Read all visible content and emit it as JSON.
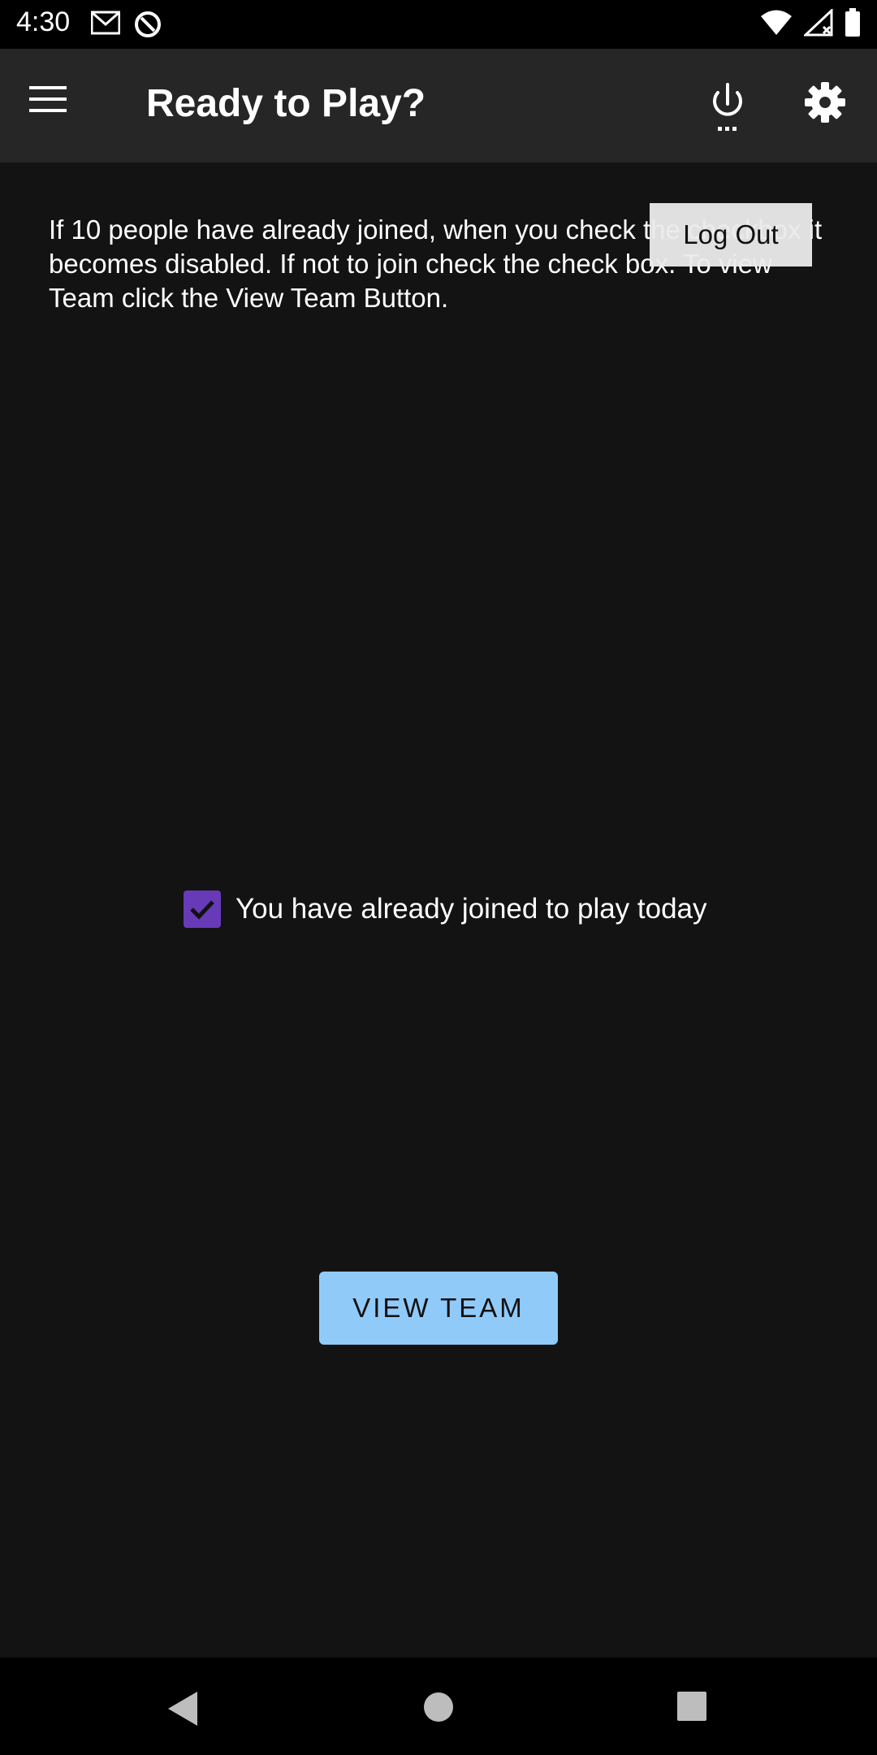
{
  "status_bar": {
    "time": "4:30",
    "left_icons": [
      "gmail-icon",
      "sync-icon"
    ],
    "right_icons": [
      "wifi-icon",
      "signal-icon",
      "battery-icon"
    ]
  },
  "app_bar": {
    "title": "Ready to Play?",
    "icons": [
      "menu-icon",
      "power-icon",
      "gear-icon"
    ]
  },
  "content": {
    "instructions": "If 10 people have already joined, when you check the checkbox it becomes disabled. If not to join check the check box. To view Team click the View Team Button.",
    "logout_label": "Log Out",
    "join_checkbox_checked": true,
    "join_label": "You have already joined to play today",
    "view_team_label": "VIEW TEAM"
  },
  "colors": {
    "background": "#131313",
    "app_bar": "#262626",
    "checkbox": "#673ab7",
    "view_team_button": "#90caf9"
  },
  "nav_bar": {
    "icons": [
      "back-icon",
      "home-icon",
      "recents-icon"
    ]
  }
}
